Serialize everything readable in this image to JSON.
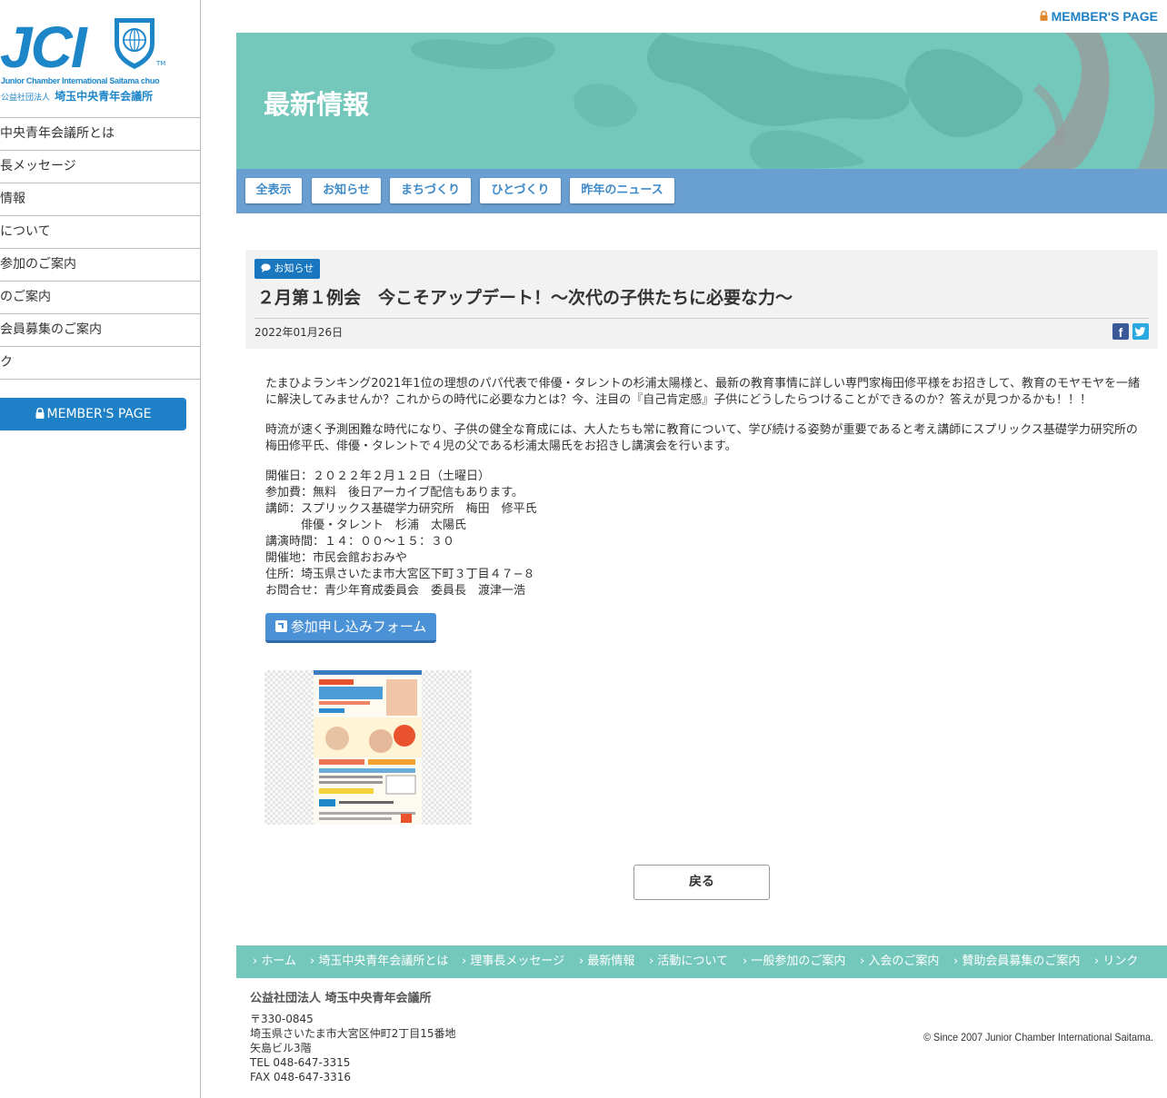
{
  "logo": {
    "mark": "JCI",
    "tm": "TM",
    "english": "Junior Chamber International Saitama chuo",
    "jp_prefix": "公益社団法人",
    "jp_name": "埼玉中央青年会議所"
  },
  "sidebar": {
    "items": [
      {
        "label": "中央青年会議所とは"
      },
      {
        "label": "長メッセージ"
      },
      {
        "label": "情報"
      },
      {
        "label": "について"
      },
      {
        "label": "参加のご案内"
      },
      {
        "label": "のご案内"
      },
      {
        "label": "会員募集のご案内"
      },
      {
        "label": "ク"
      }
    ],
    "member_label": "MEMBER'S PAGE"
  },
  "header": {
    "member_link": "MEMBER'S PAGE",
    "hero_title": "最新情報"
  },
  "categories": [
    "全表示",
    "お知らせ",
    "まちづくり",
    "ひとづくり",
    "昨年のニュース"
  ],
  "article": {
    "badge": "お知らせ",
    "title": "２月第１例会　今こそアップデート！～次代の子供たちに必要な力～",
    "date": "2022年01月26日",
    "share_fb": "f",
    "para1": "たまひよランキング2021年1位の理想のパパ代表で俳優・タレントの杉浦太陽様と、最新の教育事情に詳しい専門家梅田修平様をお招きして、教育のモヤモヤを一緒に解決してみませんか？これからの時代に必要な力とは？今、注目の『自己肯定感』子供にどうしたらつけることができるのか？答えが見つかるかも！！！",
    "para2": "時流が速く予測困難な時代になり、子供の健全な育成には、大人たちも常に教育について、学び続ける姿勢が重要であると考え講師にスプリックス基礎学力研究所の梅田修平氏、俳優・タレントで４児の父である杉浦太陽氏をお招きし講演会を行います。",
    "details": [
      "開催日：２０２２年２月１２日（土曜日）",
      "参加費：無料　後日アーカイブ配信もあります。",
      "講師：スプリックス基礎学力研究所　梅田　修平氏",
      "　　　俳優・タレント　杉浦　太陽氏",
      "講演時間：１４：００〜１５：３０",
      "開催地：市民会館おおみや",
      "住所：埼玉県さいたま市大宮区下町３丁目４７−８",
      "お問合せ：青少年育成委員会　委員長　渡津一浩"
    ],
    "form_button": "参加申し込みフォーム",
    "back_button": "戻る"
  },
  "footer": {
    "nav": [
      "ホーム",
      "埼玉中央青年会議所とは",
      "理事長メッセージ",
      "最新情報",
      "活動について",
      "一般参加のご案内",
      "入会のご案内",
      "賛助会員募集のご案内",
      "リンク"
    ],
    "org": "公益社団法人 埼玉中央青年会議所",
    "postal": "〒330-0845",
    "address1": "埼玉県さいたま市大宮区仲町2丁目15番地",
    "address2": "矢島ビル3階",
    "tel": "TEL 048-647-3315",
    "fax": "FAX 048-647-3316",
    "copyright": "© Since 2007 Junior Chamber International Saitama."
  },
  "colors": {
    "brand_blue": "#1e80c6",
    "teal": "#74c8bb",
    "category_bar": "#6a9fd1"
  }
}
